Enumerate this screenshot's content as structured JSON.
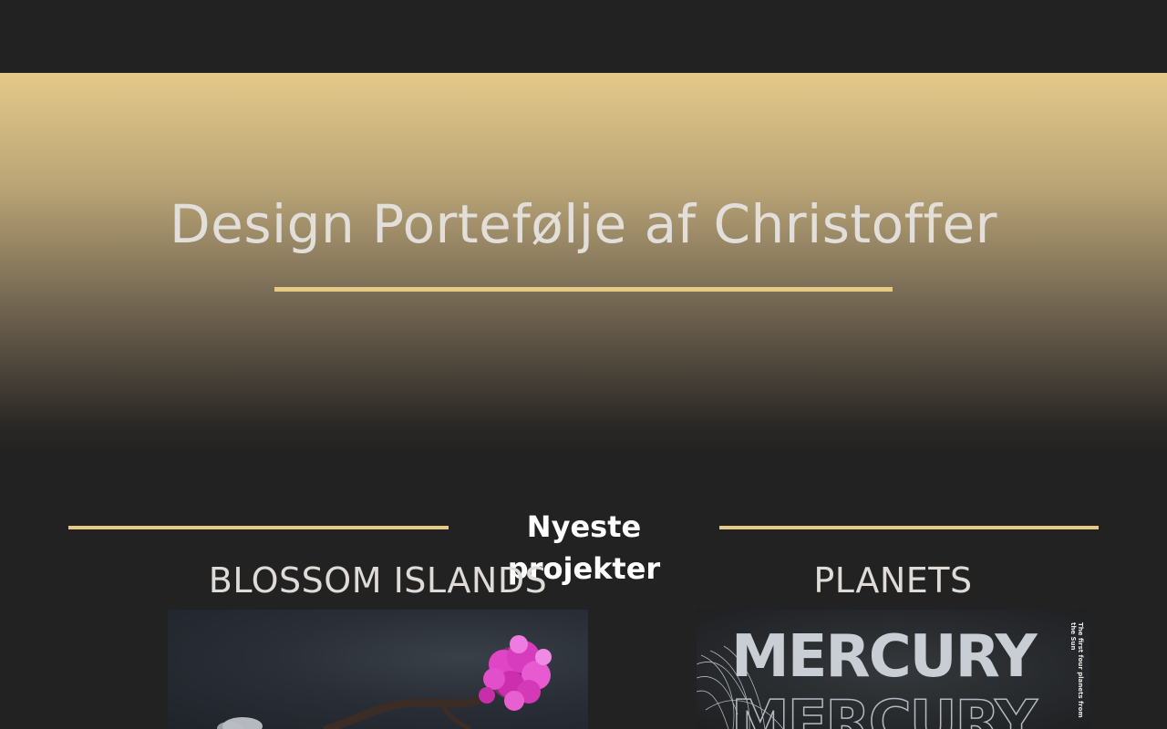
{
  "hero": {
    "title": "Design Portefølje af Christoffer",
    "gradient_top": "#e4c98a",
    "gradient_bottom": "#222222",
    "rule_color": "#e6c983"
  },
  "projects_section": {
    "heading": "Nyeste projekter",
    "line_color": "#e6c983"
  },
  "projects": [
    {
      "title": "BLOSSOM ISLANDS",
      "thumbnail": "blossom-tree-island-image"
    },
    {
      "title": "PLANETS",
      "thumbnail": "mercury-poster-image",
      "poster_word": "MERCURY",
      "poster_side_text": "The first four planets from the Sun"
    }
  ],
  "colors": {
    "background": "#222222",
    "accent": "#e6c983",
    "text": "#e2dfdb"
  }
}
